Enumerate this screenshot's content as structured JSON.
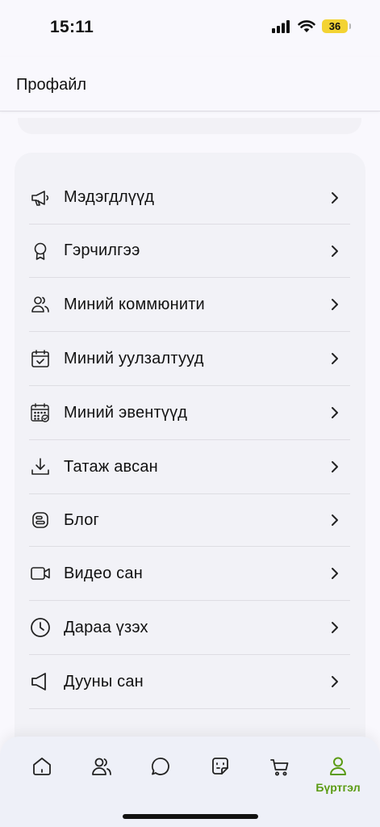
{
  "status_bar": {
    "time": "15:11",
    "battery": "36"
  },
  "header": {
    "title": "Профайл"
  },
  "menu": {
    "items": [
      {
        "label": "Мэдэгдлүүд",
        "icon": "megaphone-icon"
      },
      {
        "label": "Гэрчилгээ",
        "icon": "award-icon"
      },
      {
        "label": "Миний коммюнити",
        "icon": "users-icon"
      },
      {
        "label": "Миний уулзалтууд",
        "icon": "calendar-check-icon"
      },
      {
        "label": "Миний эвентүүд",
        "icon": "calendar-grid-icon"
      },
      {
        "label": "Татаж авсан",
        "icon": "download-icon"
      },
      {
        "label": "Блог",
        "icon": "blog-icon"
      },
      {
        "label": "Видео сан",
        "icon": "video-icon"
      },
      {
        "label": "Дараа үзэх",
        "icon": "clock-icon"
      },
      {
        "label": "Дууны сан",
        "icon": "speaker-icon"
      }
    ]
  },
  "bottom_nav": {
    "active_label": "Бүртгэл",
    "accent_color": "#5a9b12"
  }
}
